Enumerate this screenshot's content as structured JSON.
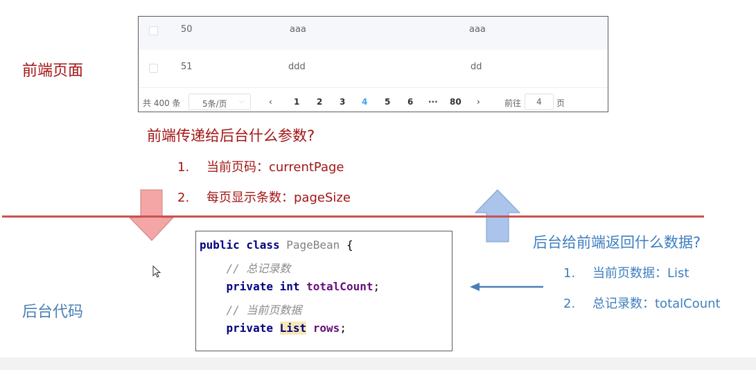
{
  "labels": {
    "frontend": "前端页面",
    "backend": "后台代码"
  },
  "table": {
    "rows": [
      {
        "id": "50",
        "col2": "aaa",
        "col3": "aaa"
      },
      {
        "id": "51",
        "col2": "ddd",
        "col3": "dd"
      }
    ],
    "pagination": {
      "total": "共 400 条",
      "page_size": "5条/页",
      "prev": "‹",
      "pages": [
        "1",
        "2",
        "3",
        "4",
        "5",
        "6",
        "···",
        "80"
      ],
      "active_page": "4",
      "next": "›",
      "goto_label": "前往",
      "goto_value": "4",
      "goto_suffix": "页"
    }
  },
  "question_frontend": {
    "title": "前端传递给后台什么参数?",
    "items": [
      {
        "num": "1.",
        "text": "当前页码：currentPage"
      },
      {
        "num": "2.",
        "text": "每页显示条数：pageSize"
      }
    ]
  },
  "question_backend": {
    "title": "后台给前端返回什么数据?",
    "items": [
      {
        "num": "1.",
        "text": "当前页数据：List"
      },
      {
        "num": "2.",
        "text": "总记录数：totalCount"
      }
    ]
  },
  "code": {
    "l1_kw": "public class",
    "l1_name": "PageBean",
    "l1_brace": "{",
    "l2_comment": "// 总记录数",
    "l3_kw": "private int",
    "l3_field": "totalCount",
    "l3_end": ";",
    "l4_comment": "// 当前页数据",
    "l5_kw": "private",
    "l5_type": "List",
    "l5_field": "rows",
    "l5_end": ";"
  },
  "colors": {
    "down_arrow": "#f4a6a6",
    "up_arrow": "#aac4ec",
    "divider": "#c9514f",
    "frontend_text": "#a31515",
    "backend_text": "#3d7ebf"
  }
}
